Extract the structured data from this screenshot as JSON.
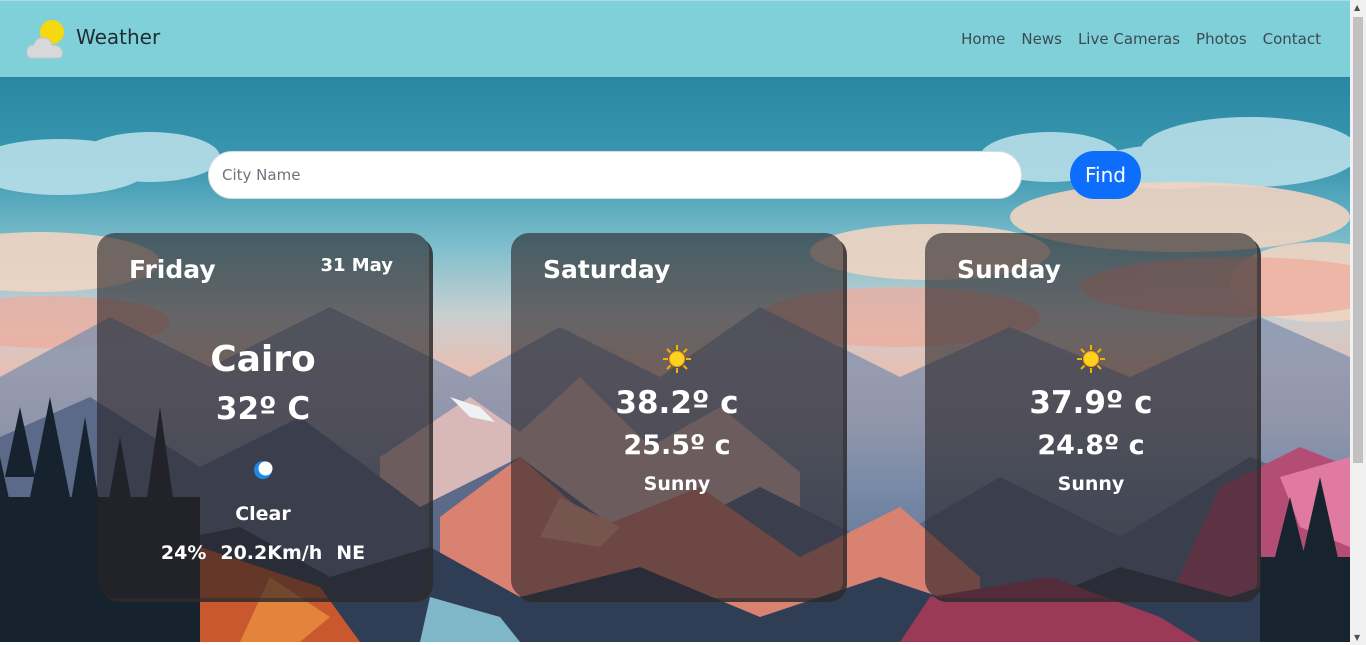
{
  "brand": {
    "title": "Weather",
    "logo_icon": "cloud-sun-icon"
  },
  "nav": {
    "items": [
      "Home",
      "News",
      "Live Cameras",
      "Photos",
      "Contact"
    ]
  },
  "search": {
    "placeholder": "City Name",
    "value": "",
    "button_label": "Find"
  },
  "colors": {
    "navbar": "#80d0da",
    "accent": "#0d6efd",
    "card": "rgba(40,36,38,0.62)"
  },
  "today": {
    "day": "Friday",
    "date": "31 May",
    "city": "Cairo",
    "temp": "32º C",
    "icon": "moon-icon",
    "condition": "Clear",
    "humidity": "24%",
    "wind": "20.2Km/h",
    "direction": "NE"
  },
  "forecast": [
    {
      "day": "Saturday",
      "icon": "sun-icon",
      "max": "38.2º c",
      "min": "25.5º c",
      "condition": "Sunny"
    },
    {
      "day": "Sunday",
      "icon": "sun-icon",
      "max": "37.9º c",
      "min": "24.8º c",
      "condition": "Sunny"
    }
  ]
}
